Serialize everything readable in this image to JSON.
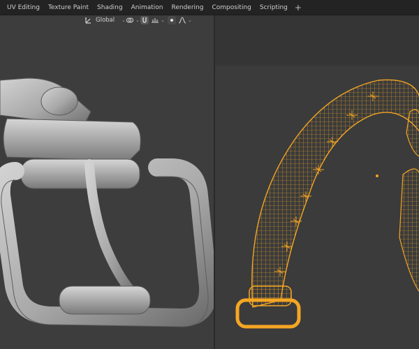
{
  "workspace_tabs": [
    "UV Editing",
    "Texture Paint",
    "Shading",
    "Animation",
    "Rendering",
    "Compositing",
    "Scripting"
  ],
  "add_tab_label": "+",
  "toolbar": {
    "transform_orientation": "Global",
    "orientation_caret": "⌄"
  },
  "colors": {
    "background": "#3d3d3d",
    "topbar": "#232323",
    "wireframe_selected": "#f5a623",
    "clay_model": "#bdbdbd"
  },
  "icons": [
    "orientation-icon",
    "link-icon",
    "snap-icon",
    "snap-increment-icon",
    "proportional-edit-icon",
    "falloff-icon"
  ]
}
